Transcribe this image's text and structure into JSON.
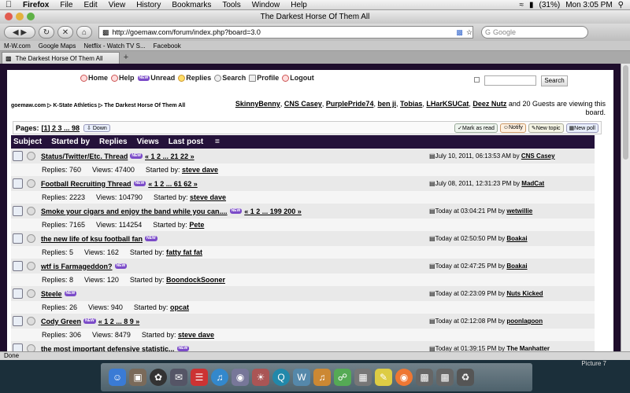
{
  "menubar": {
    "items": [
      "Firefox",
      "File",
      "Edit",
      "View",
      "History",
      "Bookmarks",
      "Tools",
      "Window",
      "Help"
    ],
    "battery": "(31%)",
    "clock": "Mon 3:05 PM"
  },
  "window": {
    "title": "The Darkest Horse Of Them All"
  },
  "nav": {
    "url": "http://goemaw.com/forum/index.php?board=3.0",
    "search_placeholder": "Google"
  },
  "bookmarks": [
    "M-W.com",
    "Google Maps",
    "Netflix - Watch TV S...",
    "Facebook"
  ],
  "tab": {
    "label": "The Darkest Horse Of Them All"
  },
  "forum": {
    "menu": [
      "Home",
      "Help",
      "Unread",
      "Replies",
      "Search",
      "Profile",
      "Logout"
    ],
    "search_button": "Search",
    "breadcrumb": "goemaw.com ▷ K-State Athletics ▷ The Darkest Horse Of Them All",
    "viewing": {
      "users": [
        "SkinnyBenny",
        "CNS Casey",
        "PurplePride74",
        "ben ji",
        "Tobias",
        "LHarKSUCat",
        "Deez Nutz"
      ],
      "suffix": "and 20 Guests are viewing this board."
    },
    "pages_label": "Pages:",
    "pages": "[1] 2 3 ... 98",
    "down_label": "Down",
    "buttons": [
      "Mark as read",
      "Notify",
      "New topic",
      "New poll"
    ],
    "headers": [
      "Subject",
      "Started by",
      "Replies",
      "Views",
      "Last post"
    ],
    "topics": [
      {
        "title": "Status/Twitter/Etc. Thread",
        "pages": "« 1 2 ... 21 22 »",
        "last_date": "July 10, 2011, 06:13:53 AM",
        "last_by": "CNS Casey",
        "replies": "Replies: 760",
        "views": "Views: 47400",
        "started_by": "steve dave"
      },
      {
        "title": "Football Recruiting Thread",
        "pages": "« 1 2 ... 61 62 »",
        "last_date": "July 08, 2011, 12:31:23 PM",
        "last_by": "MadCat",
        "replies": "Replies: 2223",
        "views": "Views: 104790",
        "started_by": "steve dave"
      },
      {
        "title": "Smoke your cigars and enjoy the band while you can....",
        "pages": "« 1 2 ... 199 200 »",
        "last_date": "Today at 03:04:21 PM",
        "last_by": "wetwillie",
        "replies": "Replies: 7165",
        "views": "Views: 114254",
        "started_by": "Pete"
      },
      {
        "title": "the new life of ksu football fan",
        "pages": "",
        "last_date": "Today at 02:50:50 PM",
        "last_by": "Boakai",
        "replies": "Replies: 5",
        "views": "Views: 162",
        "started_by": "fatty fat fat"
      },
      {
        "title": "wtf is Farmageddon?",
        "pages": "",
        "last_date": "Today at 02:47:25 PM",
        "last_by": "Boakai",
        "replies": "Replies: 8",
        "views": "Views: 120",
        "started_by": "BoondockSooner"
      },
      {
        "title": "Steele",
        "pages": "",
        "last_date": "Today at 02:23:09 PM",
        "last_by": "Nuts Kicked",
        "replies": "Replies: 26",
        "views": "Views: 940",
        "started_by": "opcat"
      },
      {
        "title": "Cody Green",
        "pages": "« 1 2 ... 8 9 »",
        "last_date": "Today at 02:12:08 PM",
        "last_by": "poonlagoon",
        "replies": "Replies: 306",
        "views": "Views: 8479",
        "started_by": "steve dave"
      },
      {
        "title": "the most important defensive statistic...",
        "pages": "",
        "last_date": "Today at 01:39:15 PM",
        "last_by": "The Manhatter",
        "replies": "",
        "views": "",
        "started_by": ""
      }
    ],
    "started_by_label": "Started by:",
    "by_label": "by"
  },
  "status": {
    "text": "Done"
  },
  "dock": {
    "picture_label": "Picture 7"
  },
  "colors": {
    "header_bg": "#24123a",
    "page_bg": "#1e0d2c",
    "new_badge": "#7b4bc8"
  }
}
